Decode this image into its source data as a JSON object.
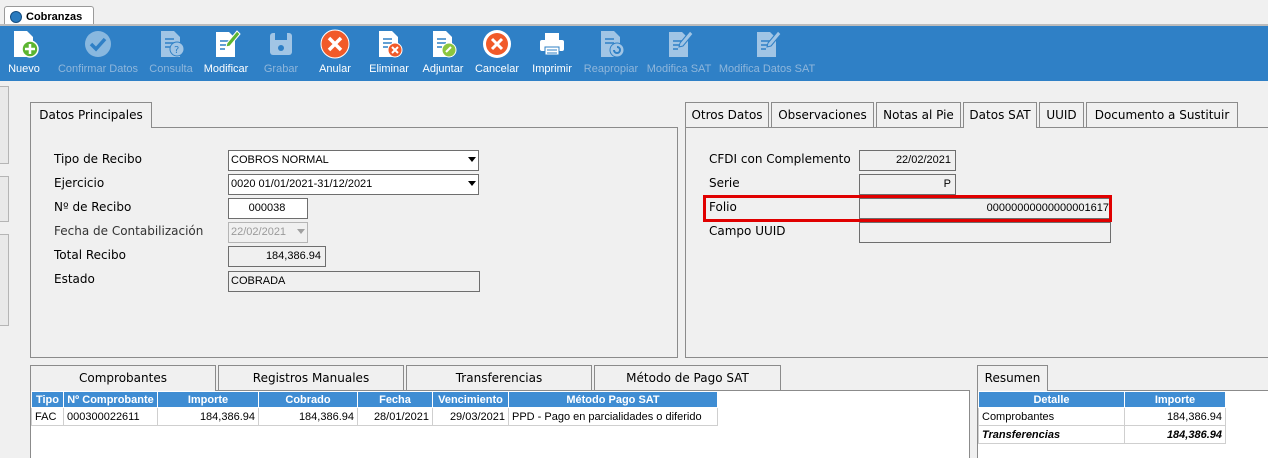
{
  "window_tab": {
    "title": "Cobranzas"
  },
  "toolbar": {
    "buttons": [
      {
        "label": "Nuevo",
        "enabled": true,
        "icon": "new-document-icon"
      },
      {
        "label": "Confirmar Datos",
        "enabled": false,
        "icon": "checkmark-icon"
      },
      {
        "label": "Consulta",
        "enabled": false,
        "icon": "query-document-icon"
      },
      {
        "label": "Modificar",
        "enabled": true,
        "icon": "edit-document-icon"
      },
      {
        "label": "Grabar",
        "enabled": false,
        "icon": "save-disk-icon"
      },
      {
        "label": "Anular",
        "enabled": true,
        "icon": "cancel-x-icon"
      },
      {
        "label": "Eliminar",
        "enabled": true,
        "icon": "delete-document-icon"
      },
      {
        "label": "Adjuntar",
        "enabled": true,
        "icon": "attach-document-icon"
      },
      {
        "label": "Cancelar",
        "enabled": true,
        "icon": "cancel-circle-icon"
      },
      {
        "label": "Imprimir",
        "enabled": true,
        "icon": "printer-icon"
      },
      {
        "label": "Reapropiar",
        "enabled": false,
        "icon": "reassign-document-icon"
      },
      {
        "label": "Modifica SAT",
        "enabled": false,
        "icon": "edit-sat-icon"
      },
      {
        "label": "Modifica Datos SAT",
        "enabled": false,
        "icon": "edit-sat-data-icon"
      }
    ]
  },
  "datos_principales": {
    "tab_label": "Datos Principales",
    "fields": {
      "tipo_recibo": {
        "label": "Tipo de Recibo",
        "value": "COBROS NORMAL"
      },
      "ejercicio": {
        "label": "Ejercicio",
        "value": "0020 01/01/2021-31/12/2021"
      },
      "numero_recibo": {
        "label": "Nº de Recibo",
        "value": "000038"
      },
      "fecha_contabilizacion": {
        "label": "Fecha de Contabilización",
        "value": "22/02/2021"
      },
      "total_recibo": {
        "label": "Total Recibo",
        "value": "184,386.94"
      },
      "estado": {
        "label": "Estado",
        "value": "COBRADA"
      }
    }
  },
  "right_tabs": {
    "tabs": [
      "Otros Datos",
      "Observaciones",
      "Notas al Pie",
      "Datos SAT",
      "UUID",
      "Documento a Sustituir"
    ],
    "active": "Datos SAT",
    "fields": {
      "cfdi_complemento": {
        "label": "CFDI con Complemento",
        "value": "22/02/2021"
      },
      "serie": {
        "label": "Serie",
        "value": "P"
      },
      "folio": {
        "label": "Folio",
        "value": "00000000000000001617"
      },
      "campo_uuid": {
        "label": "Campo UUID",
        "value": ""
      }
    },
    "highlight_color": "#e00000"
  },
  "bottom_tabs": {
    "tabs": [
      "Comprobantes",
      "Registros Manuales",
      "Transferencias",
      "Método de Pago SAT"
    ],
    "active": "Comprobantes",
    "table": {
      "headers": [
        "Tipo",
        "Nº Comprobante",
        "Importe",
        "Cobrado",
        "Fecha",
        "Vencimiento",
        "Método Pago SAT"
      ],
      "rows": [
        [
          "FAC",
          "000300022611",
          "184,386.94",
          "184,386.94",
          "28/01/2021",
          "29/03/2021",
          "PPD - Pago en parcialidades o diferido"
        ]
      ]
    }
  },
  "resumen": {
    "tab_label": "Resumen",
    "headers": [
      "Detalle",
      "Importe"
    ],
    "rows": [
      [
        "Comprobantes",
        "184,386.94"
      ],
      [
        "Transferencias",
        "184,386.94"
      ]
    ]
  },
  "colors": {
    "toolbar_bg": "#2f80c6",
    "table_header_bg": "#3f8dd3"
  }
}
